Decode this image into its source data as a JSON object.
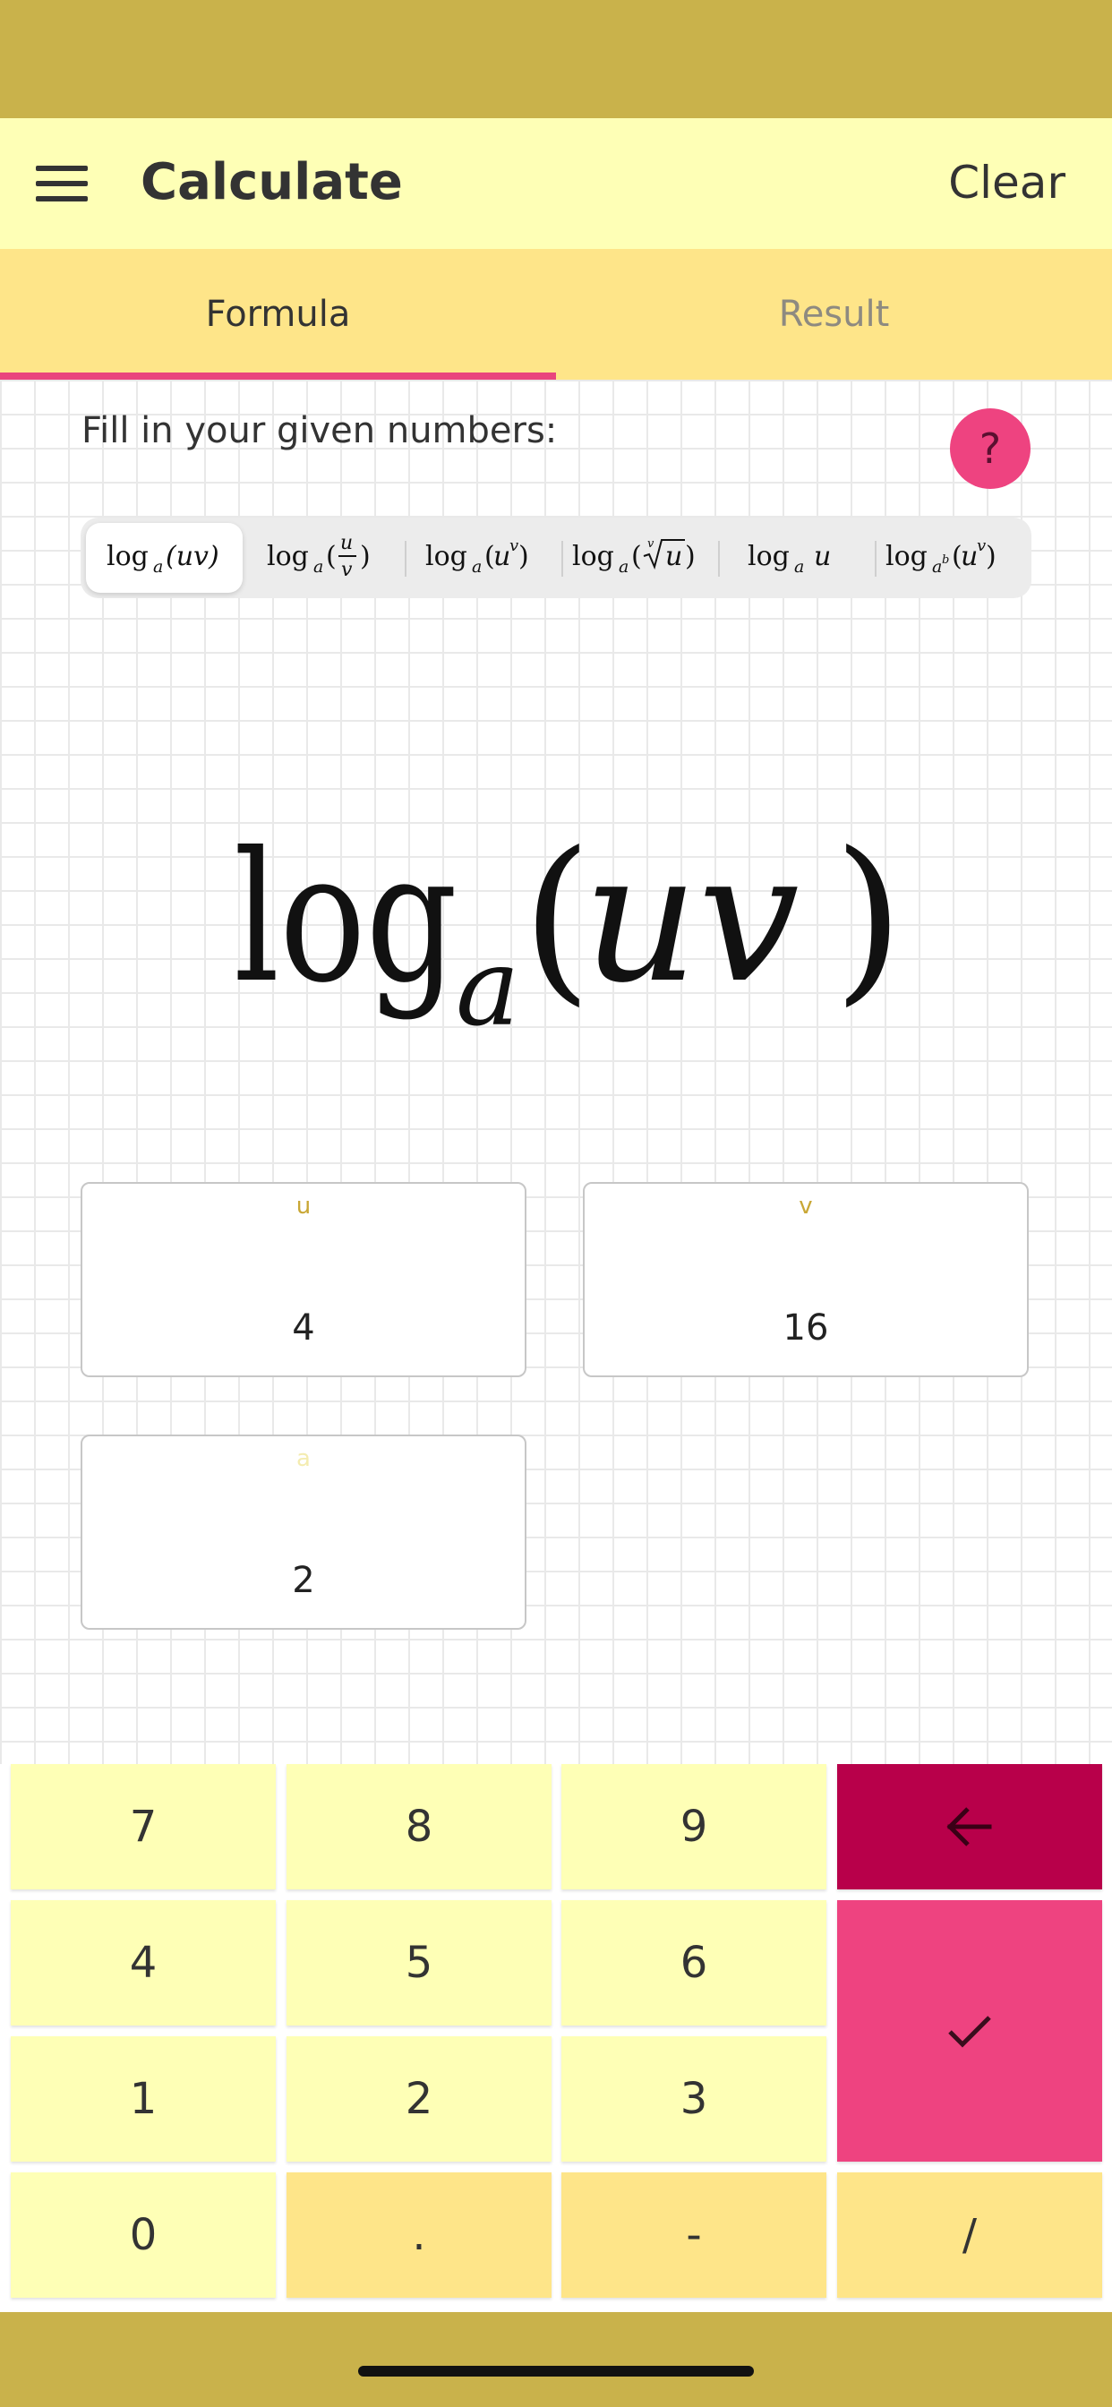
{
  "app_bar": {
    "title": "Calculate",
    "clear_label": "Clear"
  },
  "tabs": [
    {
      "label": "Formula",
      "active": true
    },
    {
      "label": "Result",
      "active": false
    }
  ],
  "prompt": "Fill in your given numbers:",
  "help_label": "?",
  "formulas": [
    {
      "label": "log_a(uv)",
      "selected": true
    },
    {
      "label": "log_a(u/v)",
      "selected": false
    },
    {
      "label": "log_a(u^v)",
      "selected": false
    },
    {
      "label": "log_a(v-th root of u)",
      "selected": false
    },
    {
      "label": "log_a u",
      "selected": false
    },
    {
      "label": "log_(a^b)(u^v)",
      "selected": false
    }
  ],
  "big_formula": {
    "base": "a",
    "arg": "uv"
  },
  "inputs": {
    "u": {
      "label": "u",
      "value": "4"
    },
    "v": {
      "label": "v",
      "value": "16"
    },
    "a": {
      "label": "a",
      "value": "2"
    }
  },
  "keypad": {
    "k7": "7",
    "k8": "8",
    "k9": "9",
    "k4": "4",
    "k5": "5",
    "k6": "6",
    "k1": "1",
    "k2": "2",
    "k3": "3",
    "k0": "0",
    "dot": ".",
    "minus": "-",
    "slash": "/",
    "backspace_icon": "arrow-left-icon",
    "confirm_icon": "check-icon"
  },
  "colors": {
    "status": "#c9b24b",
    "app_bar": "#feffb6",
    "tabs": "#fee589",
    "accent": "#e9457d",
    "backspace": "#b8004a",
    "confirm": "#ee4380"
  }
}
